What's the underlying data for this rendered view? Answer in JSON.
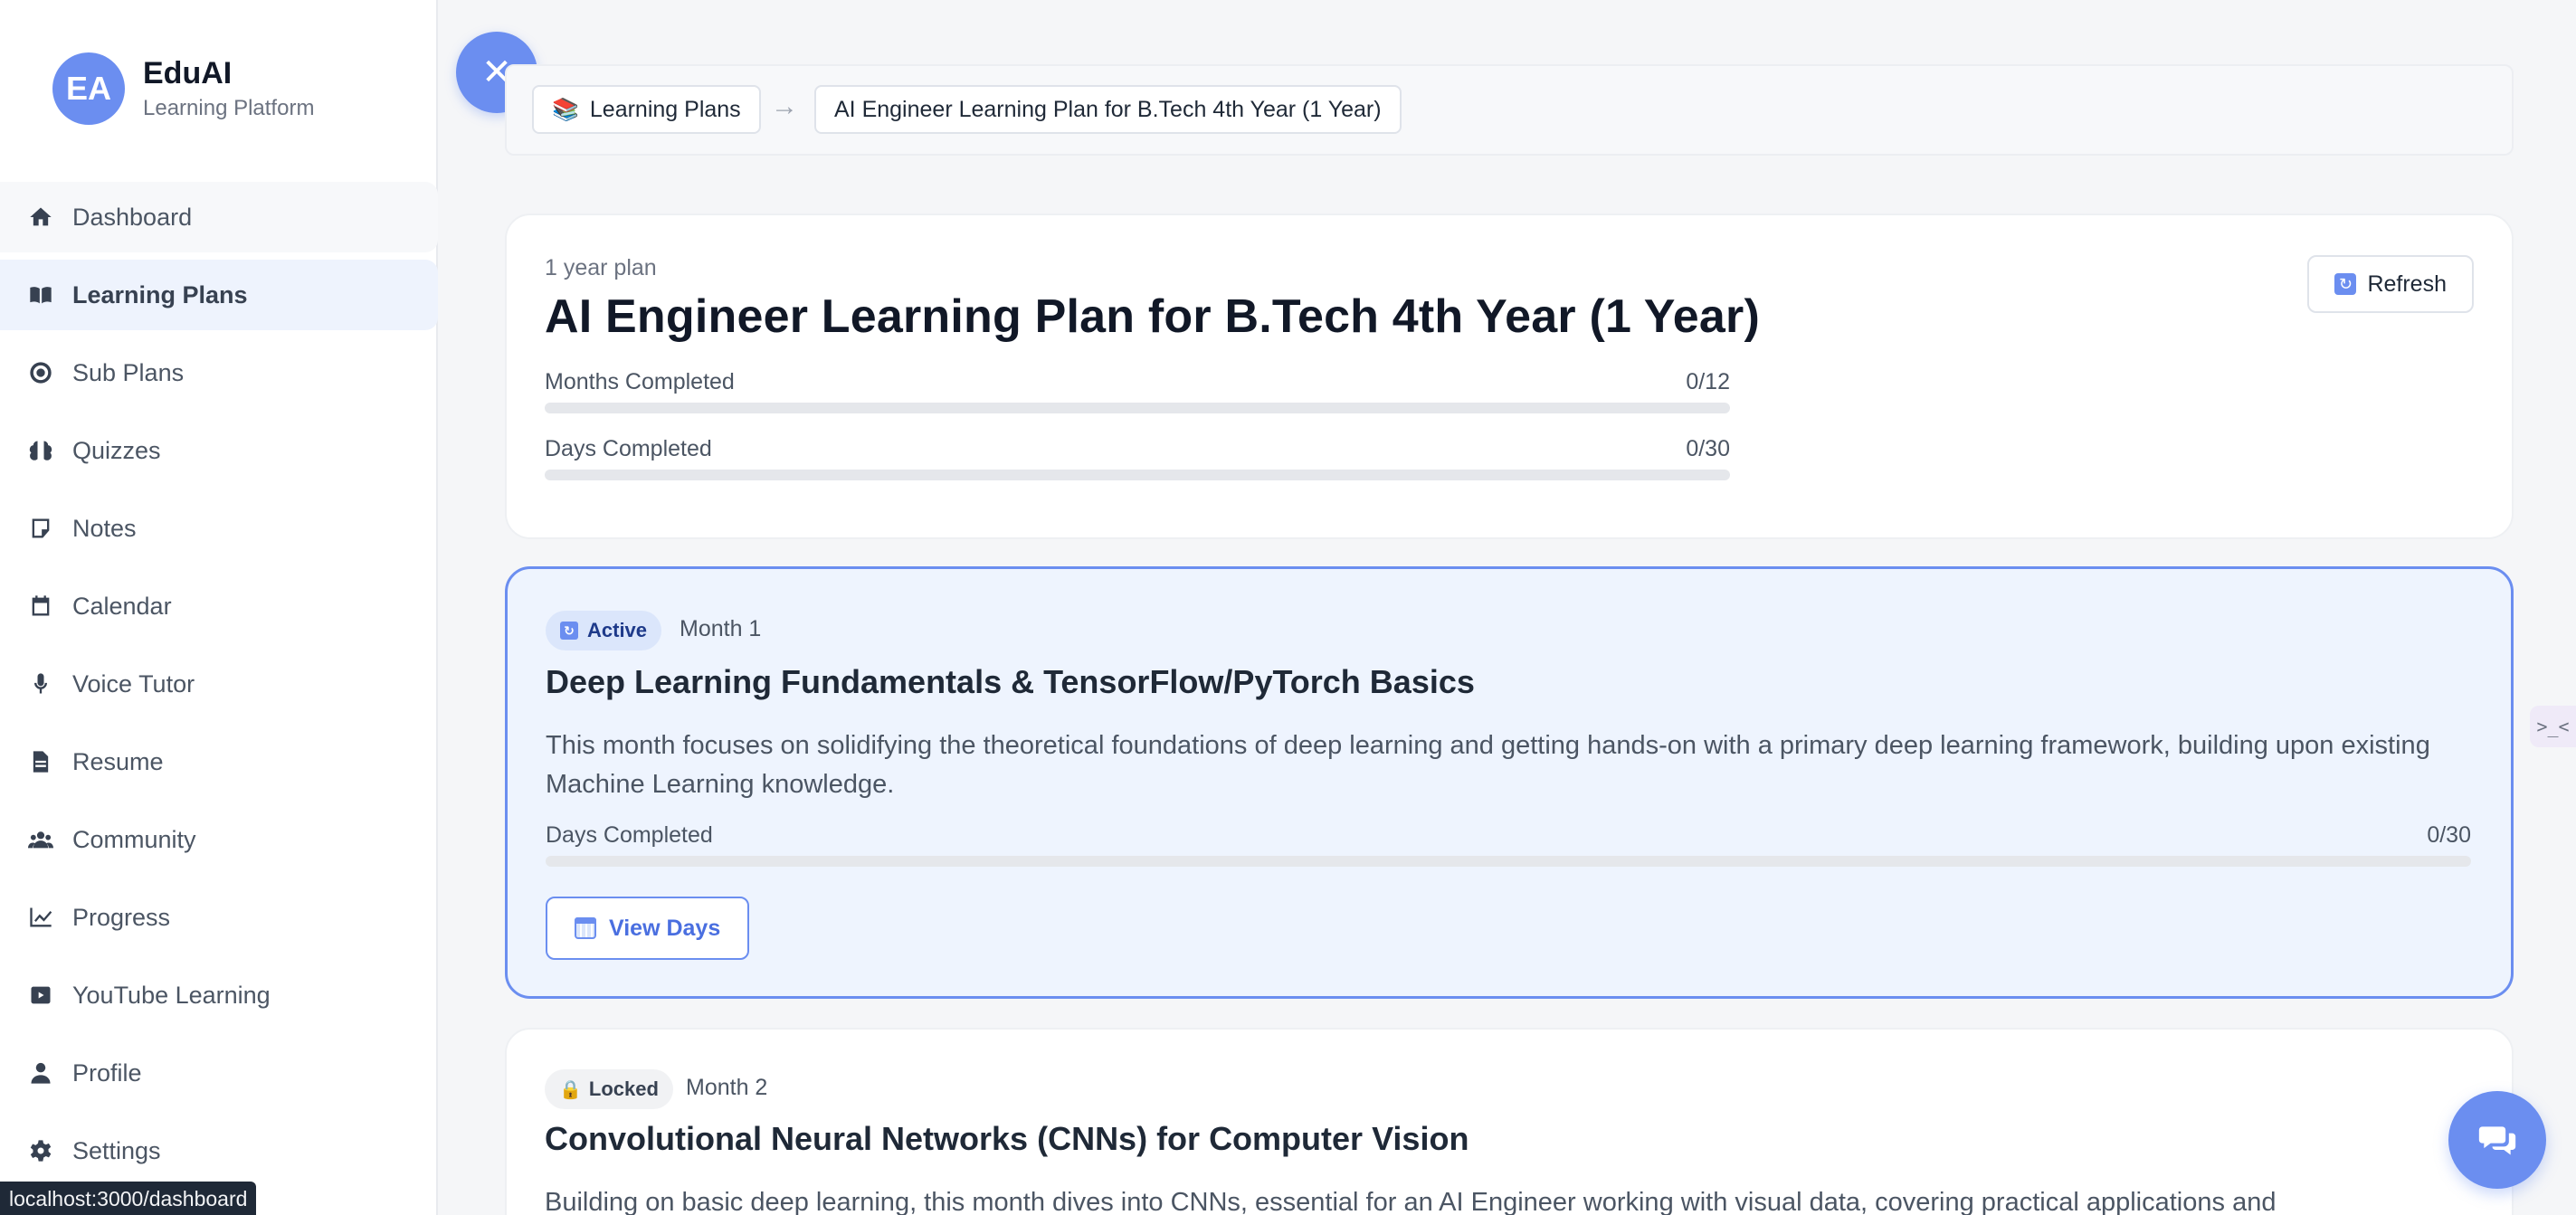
{
  "brand": {
    "initials": "EA",
    "name": "EduAI",
    "subtitle": "Learning Platform"
  },
  "sidebar": {
    "items": [
      {
        "label": "Dashboard",
        "icon": "home-icon"
      },
      {
        "label": "Learning Plans",
        "icon": "book-open-icon",
        "active": true
      },
      {
        "label": "Sub Plans",
        "icon": "target-icon"
      },
      {
        "label": "Quizzes",
        "icon": "brain-icon"
      },
      {
        "label": "Notes",
        "icon": "sticky-note-icon"
      },
      {
        "label": "Calendar",
        "icon": "calendar-icon"
      },
      {
        "label": "Voice Tutor",
        "icon": "microphone-icon"
      },
      {
        "label": "Resume",
        "icon": "file-icon"
      },
      {
        "label": "Community",
        "icon": "users-icon"
      },
      {
        "label": "Progress",
        "icon": "chart-line-icon"
      },
      {
        "label": "YouTube Learning",
        "icon": "youtube-icon"
      },
      {
        "label": "Profile",
        "icon": "user-icon"
      },
      {
        "label": "Settings",
        "icon": "gear-icon"
      }
    ]
  },
  "status_bar": {
    "url": "localhost:3000/dashboard"
  },
  "breadcrumb": {
    "root": "Learning Plans",
    "separator": "→",
    "current": "AI Engineer Learning Plan for B.Tech 4th Year (1 Year)"
  },
  "plan": {
    "tag": "1 year plan",
    "title": "AI Engineer Learning Plan for B.Tech 4th Year (1 Year)",
    "refresh_label": "Refresh",
    "months_label": "Months Completed",
    "months_value": "0/12",
    "months_fraction": 0,
    "days_label": "Days Completed",
    "days_value": "0/30",
    "days_fraction": 0
  },
  "months": [
    {
      "status": "Active",
      "month_label": "Month 1",
      "title": "Deep Learning Fundamentals & TensorFlow/PyTorch Basics",
      "description": "This month focuses on solidifying the theoretical foundations of deep learning and getting hands-on with a primary deep learning framework, building upon existing Machine Learning knowledge.",
      "days_label": "Days Completed",
      "days_value": "0/30",
      "days_fraction": 0,
      "button_label": "View Days"
    },
    {
      "status": "Locked",
      "month_label": "Month 2",
      "title": "Convolutional Neural Networks (CNNs) for Computer Vision",
      "description": "Building on basic deep learning, this month dives into CNNs, essential for an AI Engineer working with visual data, covering practical applications and"
    }
  ],
  "colors": {
    "accent": "#6b8ef0",
    "active_bg": "#eef4fe"
  }
}
